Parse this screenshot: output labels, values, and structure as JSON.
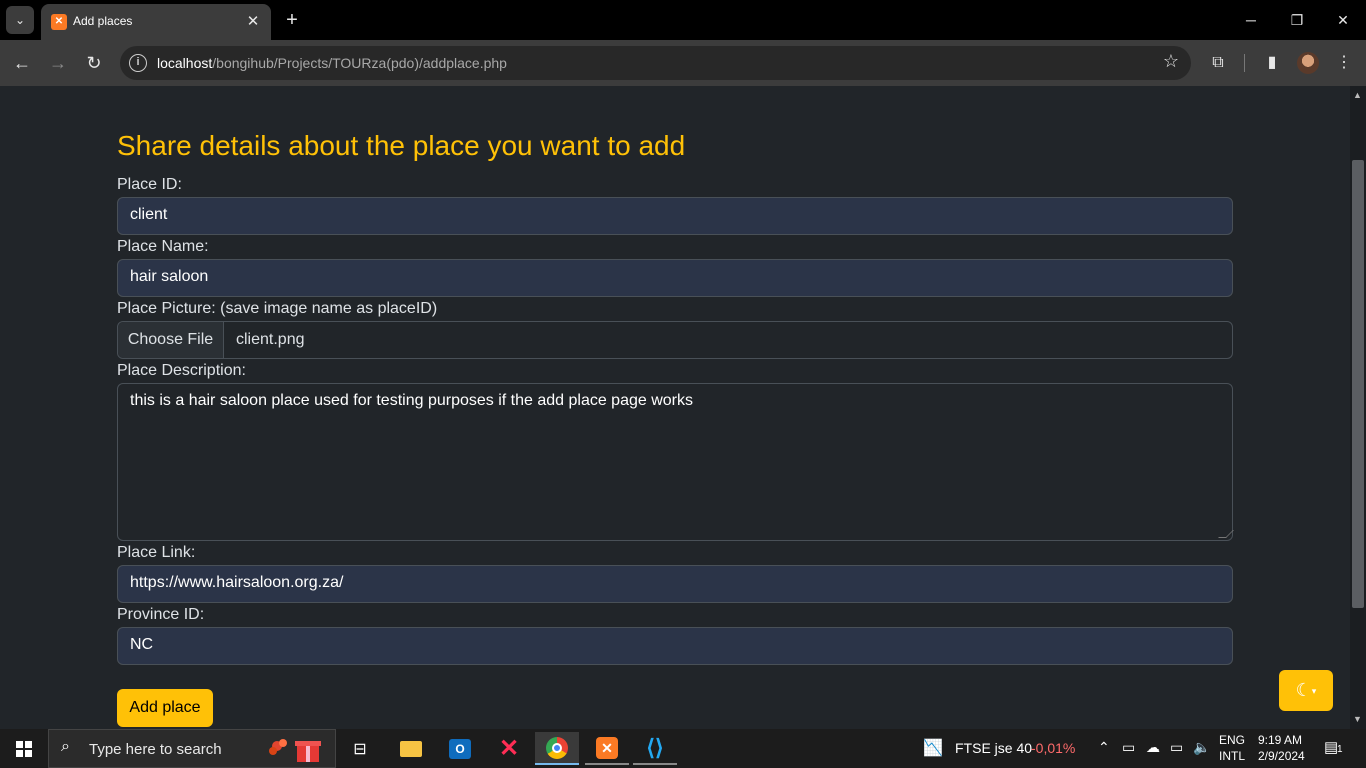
{
  "browser": {
    "tab_title": "Add places",
    "url_host": "localhost",
    "url_path": "/bongihub/Projects/TOURza(pdo)/addplace.php"
  },
  "form": {
    "title": "Share details about the place you want to add",
    "fields": {
      "place_id": {
        "label": "Place ID:",
        "value": "client"
      },
      "place_name": {
        "label": "Place Name:",
        "value": "hair saloon"
      },
      "place_picture": {
        "label": "Place Picture: (save image name as placeID)",
        "button": "Choose File",
        "file_name": "client.png"
      },
      "place_description": {
        "label": "Place Description:",
        "value": "this is a hair saloon place used for testing purposes if the add place page works"
      },
      "place_link": {
        "label": "Place Link:",
        "value": "https://www.hairsaloon.org.za/"
      },
      "province_id": {
        "label": "Province ID:",
        "value": "NC"
      }
    },
    "submit_label": "Add place"
  },
  "taskbar": {
    "search_placeholder": "Type here to search",
    "news": {
      "name": "FTSE jse 40",
      "change": "-0,01%"
    },
    "language": {
      "line1": "ENG",
      "line2": "INTL"
    },
    "clock": {
      "time": "9:19 AM",
      "date": "2/9/2024"
    },
    "notification_count": "1"
  }
}
